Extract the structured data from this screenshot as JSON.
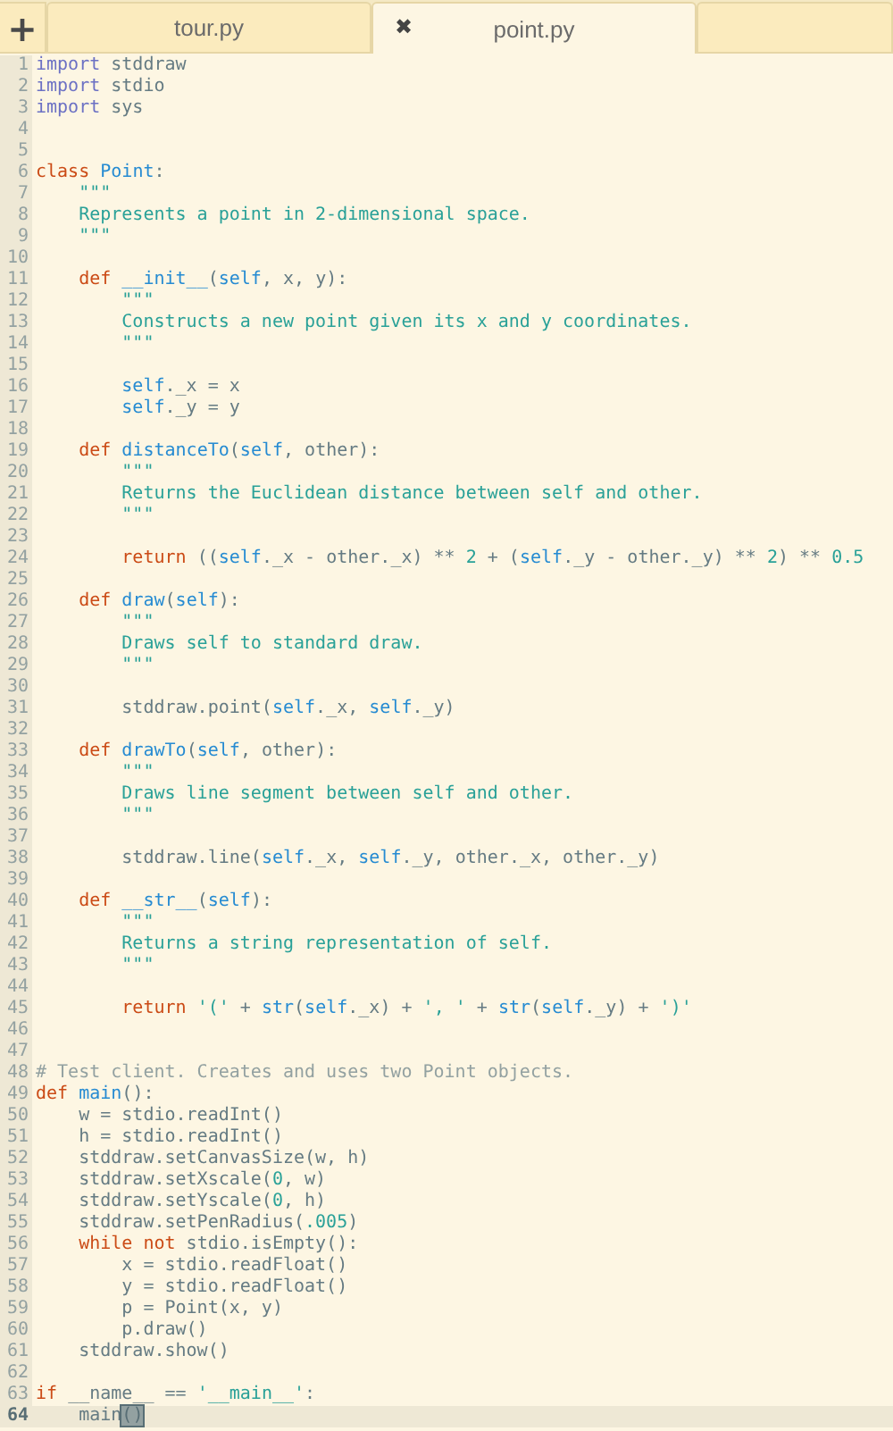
{
  "tab_bar": {
    "new_tab": "+",
    "tabs": [
      {
        "label": "tour.py",
        "selected": false
      },
      {
        "label": "point.py",
        "selected": true,
        "close": "✖"
      }
    ]
  },
  "editor": {
    "lines": [
      {
        "number": "1",
        "tokens": [
          {
            "kind": "import",
            "text": "import"
          },
          {
            "kind": "plain",
            "text": " stddraw"
          }
        ]
      },
      {
        "number": "2",
        "tokens": [
          {
            "kind": "import",
            "text": "import"
          },
          {
            "kind": "plain",
            "text": " stdio"
          }
        ]
      },
      {
        "number": "3",
        "tokens": [
          {
            "kind": "import",
            "text": "import"
          },
          {
            "kind": "plain",
            "text": " sys"
          }
        ]
      },
      {
        "number": "4"
      },
      {
        "number": "5"
      },
      {
        "number": "6",
        "tokens": [
          {
            "kind": "keyword",
            "text": "class"
          },
          {
            "kind": "name",
            "text": " Point"
          },
          {
            "kind": "plain",
            "text": ":"
          }
        ]
      },
      {
        "number": "7",
        "tokens": [
          {
            "kind": "string",
            "text": "    \"\"\""
          }
        ]
      },
      {
        "number": "8",
        "tokens": [
          {
            "kind": "string",
            "text": "    Represents a point in 2-dimensional space."
          }
        ]
      },
      {
        "number": "9",
        "tokens": [
          {
            "kind": "string",
            "text": "    \"\"\""
          }
        ]
      },
      {
        "number": "10"
      },
      {
        "number": "11",
        "tokens": [
          {
            "kind": "keyword",
            "text": "    def"
          },
          {
            "kind": "name",
            "text": " __init__"
          },
          {
            "kind": "plain",
            "text": "("
          },
          {
            "kind": "name",
            "text": "self"
          },
          {
            "kind": "plain",
            "text": ", x, y):"
          }
        ]
      },
      {
        "number": "12",
        "tokens": [
          {
            "kind": "string",
            "text": "        \"\"\""
          }
        ]
      },
      {
        "number": "13",
        "tokens": [
          {
            "kind": "string",
            "text": "        Constructs a new point given its x and y coordinates."
          }
        ]
      },
      {
        "number": "14",
        "tokens": [
          {
            "kind": "string",
            "text": "        \"\"\""
          }
        ]
      },
      {
        "number": "15"
      },
      {
        "number": "16",
        "tokens": [
          {
            "kind": "name",
            "text": "        self"
          },
          {
            "kind": "plain",
            "text": "._x = x"
          }
        ]
      },
      {
        "number": "17",
        "tokens": [
          {
            "kind": "name",
            "text": "        self"
          },
          {
            "kind": "plain",
            "text": "._y = y"
          }
        ]
      },
      {
        "number": "18"
      },
      {
        "number": "19",
        "tokens": [
          {
            "kind": "keyword",
            "text": "    def"
          },
          {
            "kind": "name",
            "text": " distanceTo"
          },
          {
            "kind": "plain",
            "text": "("
          },
          {
            "kind": "name",
            "text": "self"
          },
          {
            "kind": "plain",
            "text": ", other):"
          }
        ]
      },
      {
        "number": "20",
        "tokens": [
          {
            "kind": "string",
            "text": "        \"\"\""
          }
        ]
      },
      {
        "number": "21",
        "tokens": [
          {
            "kind": "string",
            "text": "        Returns the Euclidean distance between self and other."
          }
        ]
      },
      {
        "number": "22",
        "tokens": [
          {
            "kind": "string",
            "text": "        \"\"\""
          }
        ]
      },
      {
        "number": "23"
      },
      {
        "number": "24",
        "tokens": [
          {
            "kind": "keyword",
            "text": "        return"
          },
          {
            "kind": "plain",
            "text": " (("
          },
          {
            "kind": "name",
            "text": "self"
          },
          {
            "kind": "plain",
            "text": "._x - other._x) ** "
          },
          {
            "kind": "number",
            "text": "2"
          },
          {
            "kind": "plain",
            "text": " + ("
          },
          {
            "kind": "name",
            "text": "self"
          },
          {
            "kind": "plain",
            "text": "._y - other._y) ** "
          },
          {
            "kind": "number",
            "text": "2"
          },
          {
            "kind": "plain",
            "text": ") ** "
          },
          {
            "kind": "number",
            "text": "0.5"
          }
        ]
      },
      {
        "number": "25"
      },
      {
        "number": "26",
        "tokens": [
          {
            "kind": "keyword",
            "text": "    def"
          },
          {
            "kind": "name",
            "text": " draw"
          },
          {
            "kind": "plain",
            "text": "("
          },
          {
            "kind": "name",
            "text": "self"
          },
          {
            "kind": "plain",
            "text": "):"
          }
        ]
      },
      {
        "number": "27",
        "tokens": [
          {
            "kind": "string",
            "text": "        \"\"\""
          }
        ]
      },
      {
        "number": "28",
        "tokens": [
          {
            "kind": "string",
            "text": "        Draws self to standard draw."
          }
        ]
      },
      {
        "number": "29",
        "tokens": [
          {
            "kind": "string",
            "text": "        \"\"\""
          }
        ]
      },
      {
        "number": "30"
      },
      {
        "number": "31",
        "tokens": [
          {
            "kind": "plain",
            "text": "        stddraw.point("
          },
          {
            "kind": "name",
            "text": "self"
          },
          {
            "kind": "plain",
            "text": "._x, "
          },
          {
            "kind": "name",
            "text": "self"
          },
          {
            "kind": "plain",
            "text": "._y)"
          }
        ]
      },
      {
        "number": "32"
      },
      {
        "number": "33",
        "tokens": [
          {
            "kind": "keyword",
            "text": "    def"
          },
          {
            "kind": "name",
            "text": " drawTo"
          },
          {
            "kind": "plain",
            "text": "("
          },
          {
            "kind": "name",
            "text": "self"
          },
          {
            "kind": "plain",
            "text": ", other):"
          }
        ]
      },
      {
        "number": "34",
        "tokens": [
          {
            "kind": "string",
            "text": "        \"\"\""
          }
        ]
      },
      {
        "number": "35",
        "tokens": [
          {
            "kind": "string",
            "text": "        Draws line segment between self and other."
          }
        ]
      },
      {
        "number": "36",
        "tokens": [
          {
            "kind": "string",
            "text": "        \"\"\""
          }
        ]
      },
      {
        "number": "37"
      },
      {
        "number": "38",
        "tokens": [
          {
            "kind": "plain",
            "text": "        stddraw.line("
          },
          {
            "kind": "name",
            "text": "self"
          },
          {
            "kind": "plain",
            "text": "._x, "
          },
          {
            "kind": "name",
            "text": "self"
          },
          {
            "kind": "plain",
            "text": "._y, other._x, other._y)"
          }
        ]
      },
      {
        "number": "39"
      },
      {
        "number": "40",
        "tokens": [
          {
            "kind": "keyword",
            "text": "    def"
          },
          {
            "kind": "name",
            "text": " __str__"
          },
          {
            "kind": "plain",
            "text": "("
          },
          {
            "kind": "name",
            "text": "self"
          },
          {
            "kind": "plain",
            "text": "):"
          }
        ]
      },
      {
        "number": "41",
        "tokens": [
          {
            "kind": "string",
            "text": "        \"\"\""
          }
        ]
      },
      {
        "number": "42",
        "tokens": [
          {
            "kind": "string",
            "text": "        Returns a string representation of self."
          }
        ]
      },
      {
        "number": "43",
        "tokens": [
          {
            "kind": "string",
            "text": "        \"\"\""
          }
        ]
      },
      {
        "number": "44"
      },
      {
        "number": "45",
        "tokens": [
          {
            "kind": "keyword",
            "text": "        return"
          },
          {
            "kind": "string",
            "text": " '('"
          },
          {
            "kind": "plain",
            "text": " + "
          },
          {
            "kind": "name",
            "text": "str"
          },
          {
            "kind": "plain",
            "text": "("
          },
          {
            "kind": "name",
            "text": "self"
          },
          {
            "kind": "plain",
            "text": "._x) + "
          },
          {
            "kind": "string",
            "text": "', '"
          },
          {
            "kind": "plain",
            "text": " + "
          },
          {
            "kind": "name",
            "text": "str"
          },
          {
            "kind": "plain",
            "text": "("
          },
          {
            "kind": "name",
            "text": "self"
          },
          {
            "kind": "plain",
            "text": "._y) + "
          },
          {
            "kind": "string",
            "text": "')'"
          }
        ]
      },
      {
        "number": "46"
      },
      {
        "number": "47"
      },
      {
        "number": "48",
        "tokens": [
          {
            "kind": "comment",
            "text": "# Test client. Creates and uses two Point objects."
          }
        ]
      },
      {
        "number": "49",
        "tokens": [
          {
            "kind": "keyword",
            "text": "def"
          },
          {
            "kind": "name",
            "text": " main"
          },
          {
            "kind": "plain",
            "text": "():"
          }
        ]
      },
      {
        "number": "50",
        "tokens": [
          {
            "kind": "plain",
            "text": "    w = stdio.readInt()"
          }
        ]
      },
      {
        "number": "51",
        "tokens": [
          {
            "kind": "plain",
            "text": "    h = stdio.readInt()"
          }
        ]
      },
      {
        "number": "52",
        "tokens": [
          {
            "kind": "plain",
            "text": "    stddraw.setCanvasSize(w, h)"
          }
        ]
      },
      {
        "number": "53",
        "tokens": [
          {
            "kind": "plain",
            "text": "    stddraw.setXscale("
          },
          {
            "kind": "number",
            "text": "0"
          },
          {
            "kind": "plain",
            "text": ", w)"
          }
        ]
      },
      {
        "number": "54",
        "tokens": [
          {
            "kind": "plain",
            "text": "    stddraw.setYscale("
          },
          {
            "kind": "number",
            "text": "0"
          },
          {
            "kind": "plain",
            "text": ", h)"
          }
        ]
      },
      {
        "number": "55",
        "tokens": [
          {
            "kind": "plain",
            "text": "    stddraw.setPenRadius("
          },
          {
            "kind": "number",
            "text": ".005"
          },
          {
            "kind": "plain",
            "text": ")"
          }
        ]
      },
      {
        "number": "56",
        "tokens": [
          {
            "kind": "keyword",
            "text": "    while not"
          },
          {
            "kind": "plain",
            "text": " stdio.isEmpty():"
          }
        ]
      },
      {
        "number": "57",
        "tokens": [
          {
            "kind": "plain",
            "text": "        x = stdio.readFloat()"
          }
        ]
      },
      {
        "number": "58",
        "tokens": [
          {
            "kind": "plain",
            "text": "        y = stdio.readFloat()"
          }
        ]
      },
      {
        "number": "59",
        "tokens": [
          {
            "kind": "plain",
            "text": "        p = Point(x, y)"
          }
        ]
      },
      {
        "number": "60",
        "tokens": [
          {
            "kind": "plain",
            "text": "        p.draw()"
          }
        ]
      },
      {
        "number": "61",
        "tokens": [
          {
            "kind": "plain",
            "text": "    stddraw.show()"
          }
        ]
      },
      {
        "number": "62"
      },
      {
        "number": "63",
        "tokens": [
          {
            "kind": "keyword",
            "text": "if"
          },
          {
            "kind": "plain",
            "text": " __name__ == "
          },
          {
            "kind": "string",
            "text": "'__main__'"
          },
          {
            "kind": "plain",
            "text": ":"
          }
        ]
      },
      {
        "number": "64",
        "current": true,
        "tokens": [
          {
            "kind": "plain",
            "text": "    main"
          },
          {
            "kind": "bracket",
            "text": "()"
          }
        ]
      }
    ]
  }
}
